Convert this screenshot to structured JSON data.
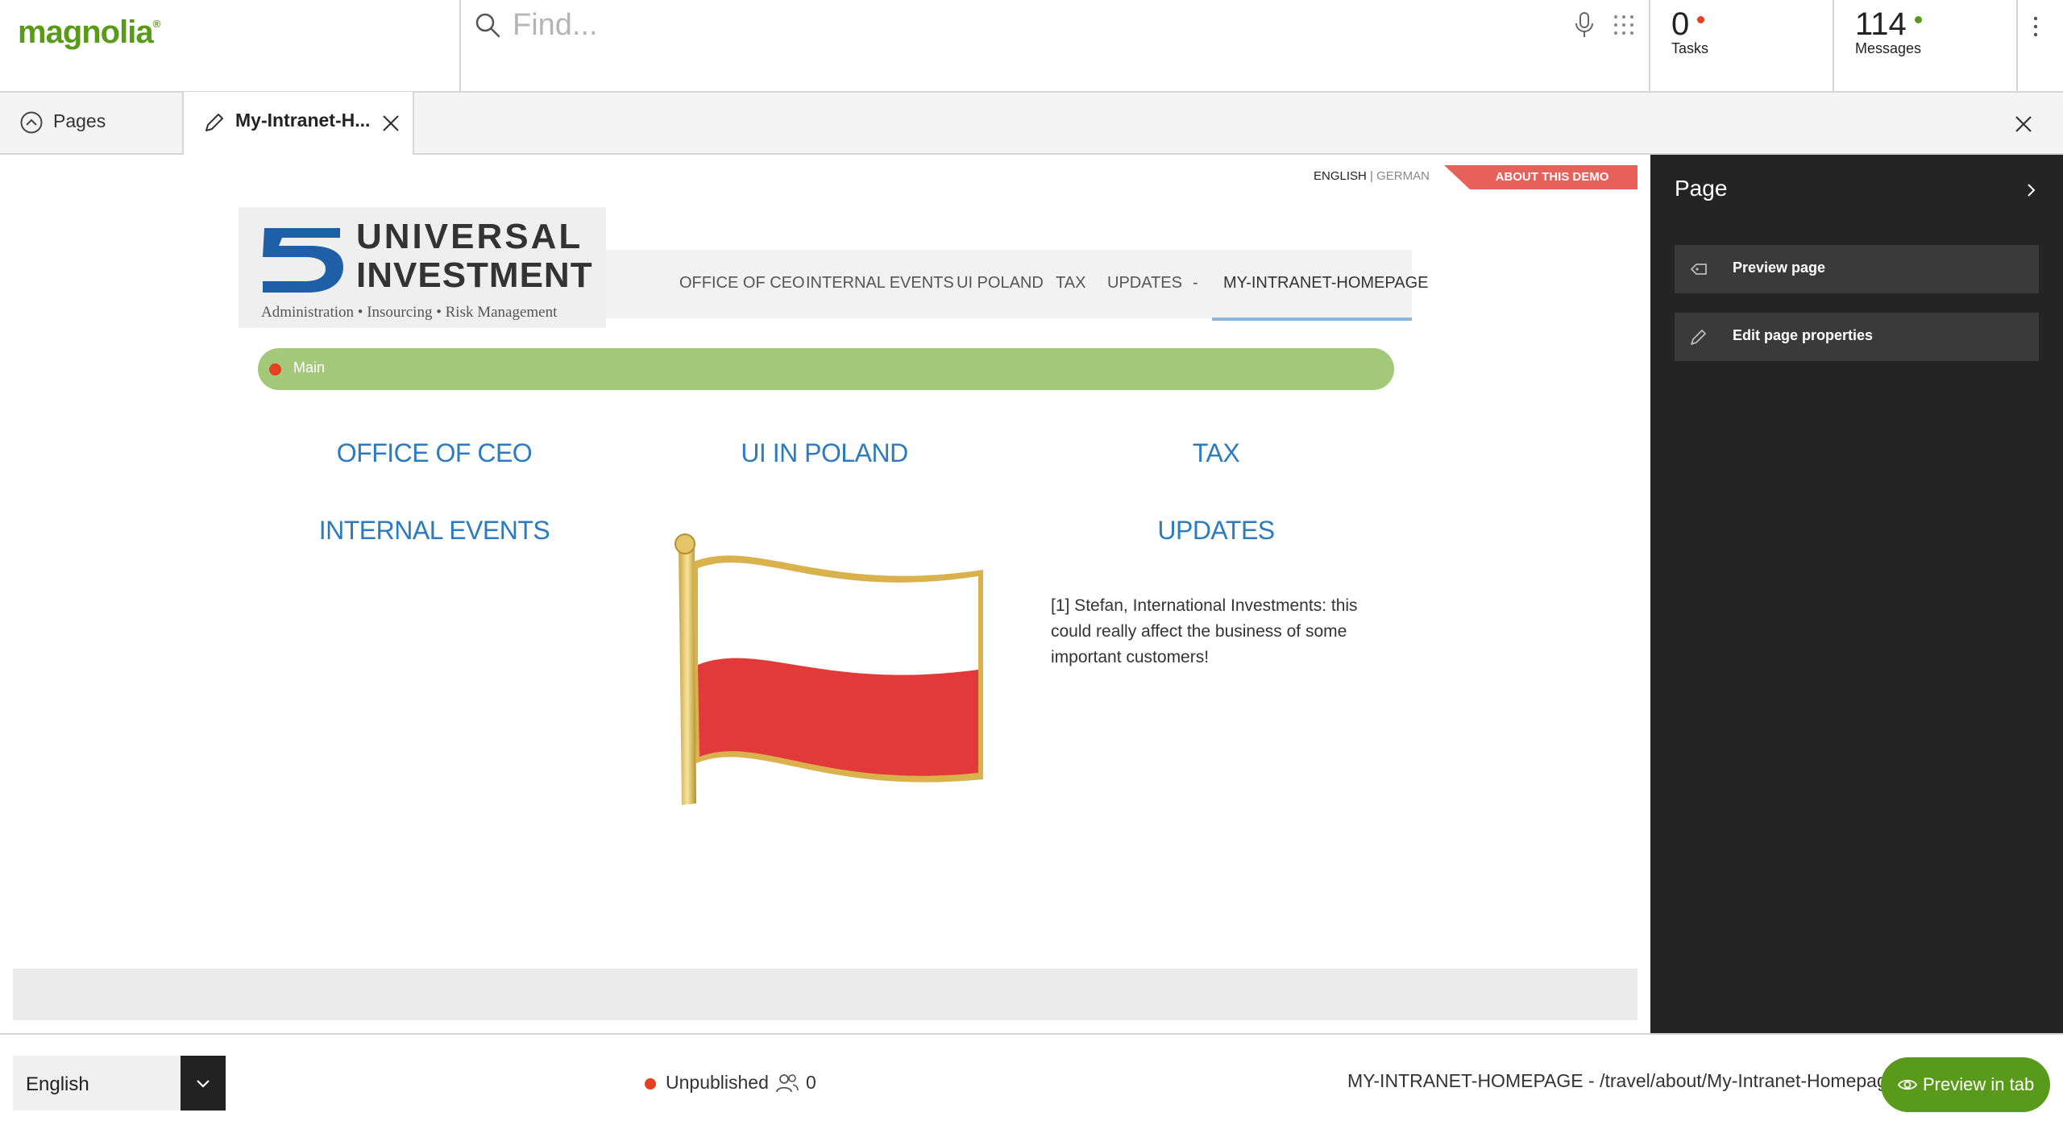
{
  "app": {
    "logo_text": "magnolia",
    "brand_color": "#5a9a1b"
  },
  "search": {
    "placeholder": "Find..."
  },
  "header": {
    "tasks": {
      "count": "0",
      "label": "Tasks",
      "dot_color": "#e2421f"
    },
    "messages": {
      "count": "114",
      "label": "Messages",
      "dot_color": "#5a9a1b"
    }
  },
  "tabs": {
    "pages_label": "Pages",
    "edit_label": "My-Intranet-H..."
  },
  "site": {
    "lang_active": "ENGLISH",
    "lang_sep": "|",
    "lang_inactive": "GERMAN",
    "about_demo": "ABOUT THIS DEMO",
    "logo_word1": "UNIVERSAL",
    "logo_word2": "INVESTMENT",
    "logo_tagline": "Administration • Insourcing • Risk Management",
    "nav": [
      "OFFICE OF CEO",
      "INTERNAL EVENTS",
      "UI POLAND",
      "TAX",
      "UPDATES",
      "-",
      "MY-INTRANET-HOMEPAGE"
    ],
    "area_label": "Main",
    "columns": {
      "col1_title1": "OFFICE OF CEO",
      "col1_title2": "INTERNAL EVENTS",
      "col2_title": "UI IN POLAND",
      "col3_title1": "TAX",
      "col3_title2": "UPDATES"
    },
    "news_text": "[1] Stefan, International Investments: this could really affect the business of some important customers!"
  },
  "panel": {
    "title": "Page",
    "preview_page": "Preview page",
    "edit_properties": "Edit page properties"
  },
  "footer": {
    "language": "English",
    "status": "Unpublished",
    "users_count": "0",
    "path": "MY-INTRANET-HOMEPAGE - /travel/about/My-Intranet-Homepage",
    "preview_tab": "Preview in tab"
  }
}
